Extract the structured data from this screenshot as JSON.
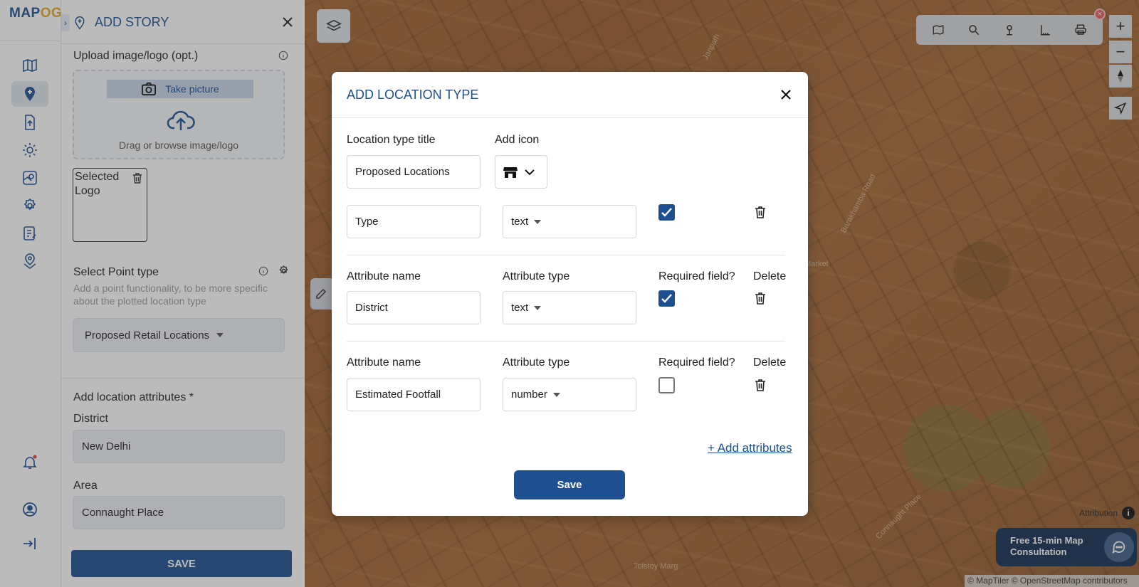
{
  "app": {
    "logo_main": "MAP",
    "logo_accent": "OG"
  },
  "panel": {
    "title": "ADD STORY",
    "collapse_glyph": "›",
    "upload_label": "Upload image/logo (opt.)",
    "take_picture": "Take picture",
    "upload_hint": "Drag or browse image/logo",
    "thumb_alt": "Selected Logo",
    "point_type_label": "Select Point type",
    "point_type_help": "Add a point functionality, to be more specific about the plotted location type",
    "point_type_value": "Proposed Retail Locations",
    "attributes_label": "Add location attributes *",
    "district_label": "District",
    "district_value": "New Delhi",
    "area_label": "Area",
    "area_value": "Connaught Place",
    "save_label": "SAVE"
  },
  "map": {
    "labels": [
      "Market",
      "Tolstoy Marg",
      "Barakhamba Road",
      "Janpath",
      "Connaught Place"
    ],
    "attribution": "Attribution",
    "copyright": "© MapTiler © OpenStreetMap contributors",
    "zoom_in": "+",
    "zoom_out": "−",
    "consult_line1": "Free 15-min Map",
    "consult_line2": "Consultation"
  },
  "modal": {
    "title": "ADD LOCATION TYPE",
    "title_label": "Location type title",
    "title_value": "Proposed Locations",
    "icon_label": "Add icon",
    "rows": [
      {
        "name_label": "",
        "type_label": "",
        "req_label": "",
        "del_label": "",
        "name": "Type",
        "type": "text",
        "required": true
      },
      {
        "name_label": "Attribute name",
        "type_label": "Attribute type",
        "req_label": "Required field?",
        "del_label": "Delete",
        "name": "District",
        "type": "text",
        "required": true
      },
      {
        "name_label": "Attribute name",
        "type_label": "Attribute type",
        "req_label": "Required field?",
        "del_label": "Delete",
        "name": "Estimated Footfall",
        "type": "number",
        "required": false
      }
    ],
    "add_attributes": "+ Add attributes",
    "save_label": "Save"
  },
  "colors": {
    "brand": "#1d4f91",
    "accent": "#e5a823"
  }
}
